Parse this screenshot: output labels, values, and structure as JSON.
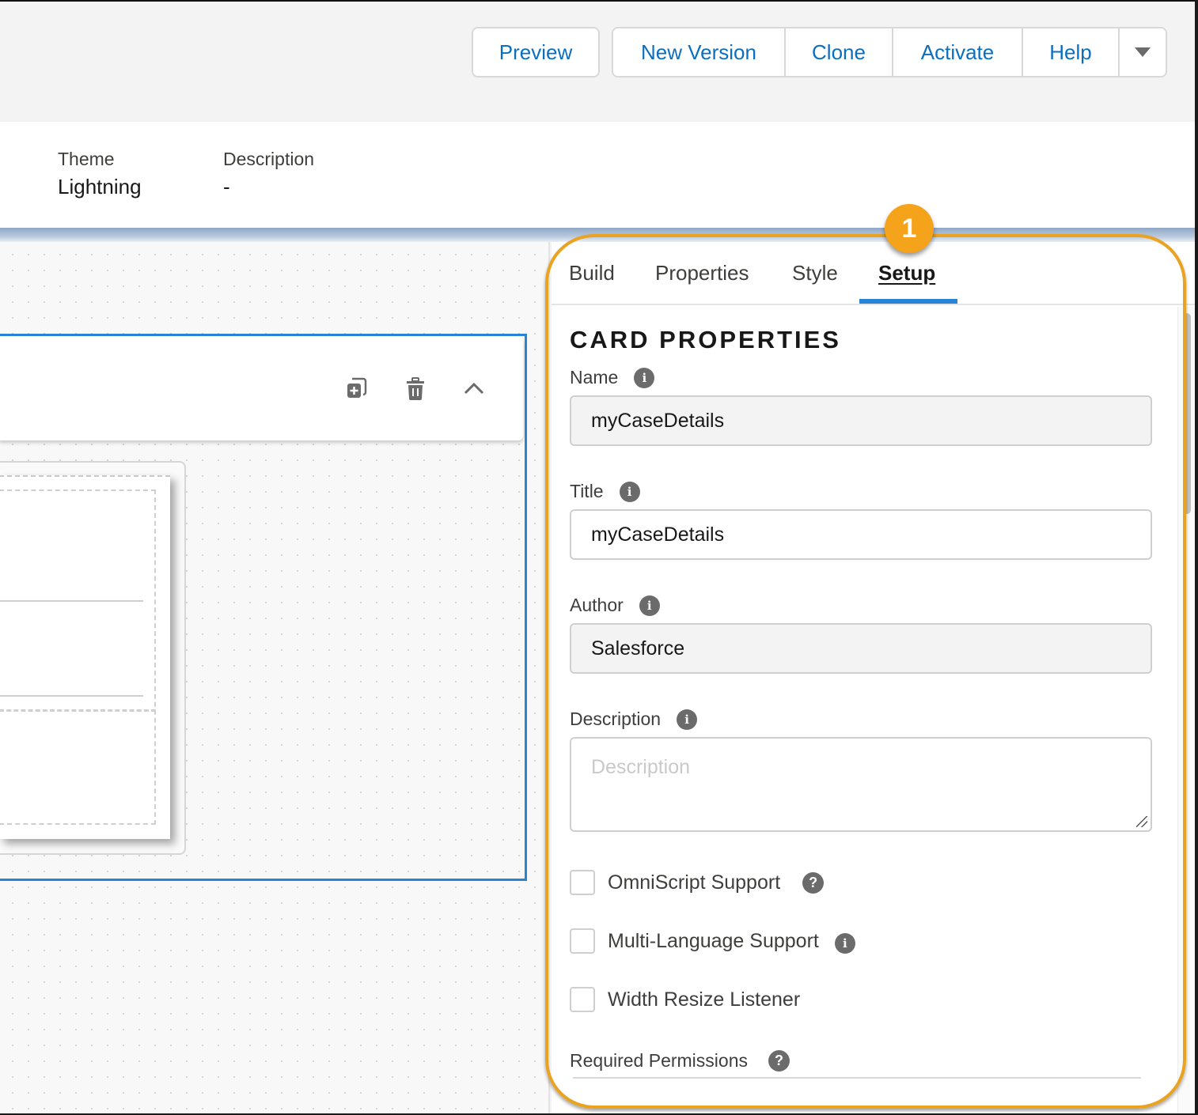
{
  "header": {
    "preview_label": "Preview",
    "buttons": [
      "New Version",
      "Clone",
      "Activate",
      "Help"
    ],
    "more_icon": "caret-down-icon"
  },
  "info": {
    "theme_label": "Theme",
    "theme_value": "Lightning",
    "description_label": "Description",
    "description_value": "-"
  },
  "canvas": {
    "card_actions": [
      "clone-add-icon",
      "trash-icon",
      "chevron-up-icon"
    ]
  },
  "panel": {
    "tabs": [
      "Build",
      "Properties",
      "Style",
      "Setup"
    ],
    "active_tab": "Setup",
    "section_title": "CARD PROPERTIES",
    "fields": {
      "name": {
        "label": "Name",
        "value": "myCaseDetails",
        "readonly": true
      },
      "title": {
        "label": "Title",
        "value": "myCaseDetails",
        "readonly": false
      },
      "author": {
        "label": "Author",
        "value": "Salesforce",
        "readonly": true
      },
      "description": {
        "label": "Description",
        "value": "",
        "placeholder": "Description"
      }
    },
    "checkboxes": [
      {
        "label": "OmniScript Support",
        "checked": false,
        "icon": "help-icon"
      },
      {
        "label": "Multi-Language Support",
        "checked": false,
        "icon": "info-icon"
      },
      {
        "label": "Width Resize Listener",
        "checked": false
      }
    ],
    "required_permissions_label": "Required Permissions"
  },
  "annotation": {
    "badge": "1",
    "color": "#f4a31b"
  },
  "colors": {
    "accent_blue": "#2a84d6",
    "link_blue": "#0b6fc0"
  }
}
